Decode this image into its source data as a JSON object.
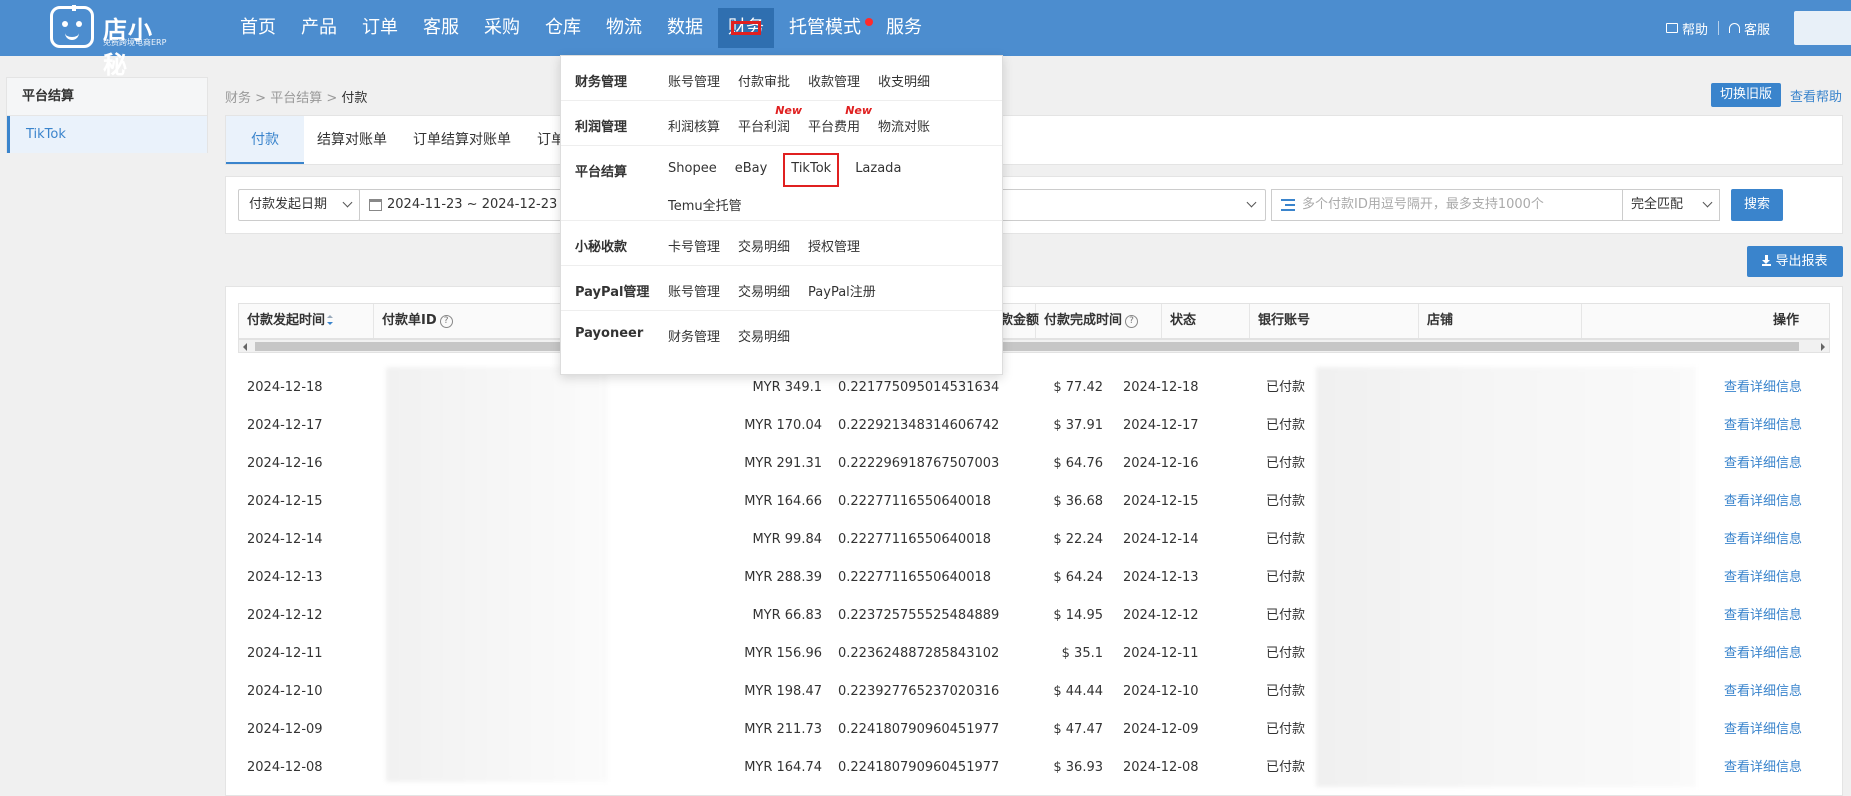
{
  "logo": {
    "title": "店小秘",
    "subtitle": "免费跨境电商ERP"
  },
  "nav": [
    {
      "label": "首页"
    },
    {
      "label": "产品"
    },
    {
      "label": "订单"
    },
    {
      "label": "客服"
    },
    {
      "label": "采购"
    },
    {
      "label": "仓库"
    },
    {
      "label": "物流"
    },
    {
      "label": "数据"
    },
    {
      "label": "财务",
      "active": true
    },
    {
      "label": "托管模式",
      "dot": true
    },
    {
      "label": "服务"
    }
  ],
  "topRight": {
    "help": "帮助",
    "service": "客服"
  },
  "sidebar": {
    "title": "平台结算",
    "items": [
      {
        "label": "TikTok"
      }
    ]
  },
  "breadcrumb": {
    "a": "财务",
    "b": "平台结算",
    "c": "付款",
    "sep": ">"
  },
  "actions": {
    "oldVersion": "切换旧版",
    "viewHelp": "查看帮助",
    "export": "导出报表"
  },
  "tabs": [
    {
      "label": "付款",
      "active": true
    },
    {
      "label": "结算对账单"
    },
    {
      "label": "订单结算对账单"
    },
    {
      "label": "订单"
    }
  ],
  "filter": {
    "dateType": "付款发起日期",
    "dateRange": "2024-11-23 ~ 2024-12-23",
    "idPlaceholder": "多个付款ID用逗号隔开，最多支持1000个",
    "match": "完全匹配",
    "search": "搜索"
  },
  "table": {
    "headers": {
      "time": "付款发起时间",
      "id": "付款单ID",
      "usd": "付款金额",
      "done": "付款完成时间",
      "status": "状态",
      "bank": "银行账号",
      "shop": "店铺",
      "op": "操作"
    },
    "rows": [
      {
        "time": "2024-12-18",
        "amount": "MYR 349.1",
        "rate": "0.221775095014531634",
        "usd": "$ 77.42",
        "done": "2024-12-18",
        "status": "已付款",
        "op": "查看详细信息"
      },
      {
        "time": "2024-12-17",
        "amount": "MYR 170.04",
        "rate": "0.222921348314606742",
        "usd": "$ 37.91",
        "done": "2024-12-17",
        "status": "已付款",
        "op": "查看详细信息"
      },
      {
        "time": "2024-12-16",
        "amount": "MYR 291.31",
        "rate": "0.222296918767507003",
        "usd": "$ 64.76",
        "done": "2024-12-16",
        "status": "已付款",
        "op": "查看详细信息"
      },
      {
        "time": "2024-12-15",
        "amount": "MYR 164.66",
        "rate": "0.22277116550640018",
        "usd": "$ 36.68",
        "done": "2024-12-15",
        "status": "已付款",
        "op": "查看详细信息"
      },
      {
        "time": "2024-12-14",
        "amount": "MYR 99.84",
        "rate": "0.22277116550640018",
        "usd": "$ 22.24",
        "done": "2024-12-14",
        "status": "已付款",
        "op": "查看详细信息"
      },
      {
        "time": "2024-12-13",
        "amount": "MYR 288.39",
        "rate": "0.22277116550640018",
        "usd": "$ 64.24",
        "done": "2024-12-13",
        "status": "已付款",
        "op": "查看详细信息"
      },
      {
        "time": "2024-12-12",
        "amount": "MYR 66.83",
        "rate": "0.223725755525484889",
        "usd": "$ 14.95",
        "done": "2024-12-12",
        "status": "已付款",
        "op": "查看详细信息"
      },
      {
        "time": "2024-12-11",
        "amount": "MYR 156.96",
        "rate": "0.223624887285843102",
        "usd": "$ 35.1",
        "done": "2024-12-11",
        "status": "已付款",
        "op": "查看详细信息"
      },
      {
        "time": "2024-12-10",
        "amount": "MYR 198.47",
        "rate": "0.223927765237020316",
        "usd": "$ 44.44",
        "done": "2024-12-10",
        "status": "已付款",
        "op": "查看详细信息"
      },
      {
        "time": "2024-12-09",
        "amount": "MYR 211.73",
        "rate": "0.224180790960451977",
        "usd": "$ 47.47",
        "done": "2024-12-09",
        "status": "已付款",
        "op": "查看详细信息"
      },
      {
        "time": "2024-12-08",
        "amount": "MYR 164.74",
        "rate": "0.224180790960451977",
        "usd": "$ 36.93",
        "done": "2024-12-08",
        "status": "已付款",
        "op": "查看详细信息"
      }
    ]
  },
  "dropdown": [
    {
      "cat": "财务管理",
      "links": [
        {
          "label": "账号管理"
        },
        {
          "label": "付款审批"
        },
        {
          "label": "收款管理"
        },
        {
          "label": "收支明细"
        }
      ]
    },
    {
      "cat": "利润管理",
      "links": [
        {
          "label": "利润核算"
        },
        {
          "label": "平台利润",
          "badge": "New"
        },
        {
          "label": "平台费用",
          "badge": "New"
        },
        {
          "label": "物流对账"
        }
      ]
    },
    {
      "cat": "平台结算",
      "links": [
        {
          "label": "Shopee"
        },
        {
          "label": "eBay"
        },
        {
          "label": "TikTok",
          "boxed": true
        },
        {
          "label": "Lazada"
        },
        {
          "label": "Temu全托管"
        }
      ]
    },
    {
      "cat": "小秘收款",
      "links": [
        {
          "label": "卡号管理"
        },
        {
          "label": "交易明细"
        },
        {
          "label": "授权管理"
        }
      ]
    },
    {
      "cat": "PayPal管理",
      "links": [
        {
          "label": "账号管理"
        },
        {
          "label": "交易明细"
        },
        {
          "label": "PayPal注册"
        }
      ]
    },
    {
      "cat": "Payoneer",
      "links": [
        {
          "label": "财务管理"
        },
        {
          "label": "交易明细"
        }
      ]
    }
  ]
}
